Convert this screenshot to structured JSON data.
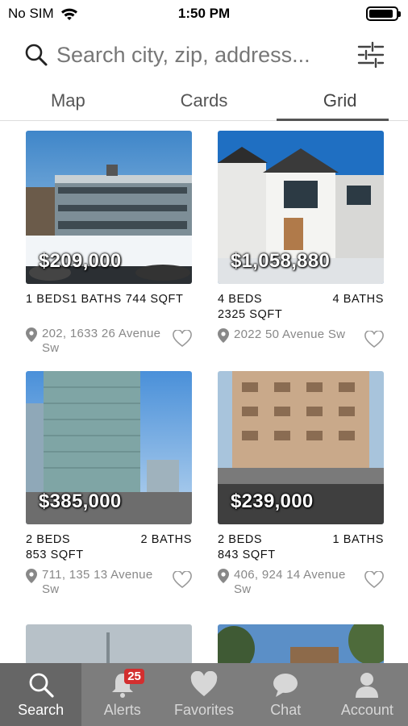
{
  "status": {
    "carrier": "No SIM",
    "time": "1:50 PM",
    "battery_level": 0.9
  },
  "search": {
    "placeholder": "Search city, zip, address..."
  },
  "tabs": [
    {
      "label": "Map",
      "active": false
    },
    {
      "label": "Cards",
      "active": false
    },
    {
      "label": "Grid",
      "active": true
    }
  ],
  "listings": [
    {
      "price": "$209,000",
      "beds": "1 BEDS",
      "baths": "1 BATHS",
      "sqft": "744 SQFT",
      "address": "202, 1633 26 Avenue Sw"
    },
    {
      "price": "$1,058,880",
      "beds": "4 BEDS",
      "baths": "4 BATHS",
      "sqft": "2325 SQFT",
      "address": "2022 50 Avenue Sw"
    },
    {
      "price": "$385,000",
      "beds": "2 BEDS",
      "baths": "2 BATHS",
      "sqft": "853 SQFT",
      "address": "711, 135 13 Avenue Sw"
    },
    {
      "price": "$239,000",
      "beds": "2 BEDS",
      "baths": "1 BATHS",
      "sqft": "843 SQFT",
      "address": "406, 924 14 Avenue Sw"
    }
  ],
  "nav": {
    "items": [
      {
        "label": "Search",
        "icon": "search-icon",
        "active": true
      },
      {
        "label": "Alerts",
        "icon": "bell-icon",
        "badge": "25"
      },
      {
        "label": "Favorites",
        "icon": "heart-icon"
      },
      {
        "label": "Chat",
        "icon": "chat-bubble-icon"
      },
      {
        "label": "Account",
        "icon": "person-icon"
      }
    ]
  },
  "colors": {
    "nav_bg": "#7d7d7d",
    "nav_active_bg": "#666666",
    "badge": "#d32f2f"
  }
}
